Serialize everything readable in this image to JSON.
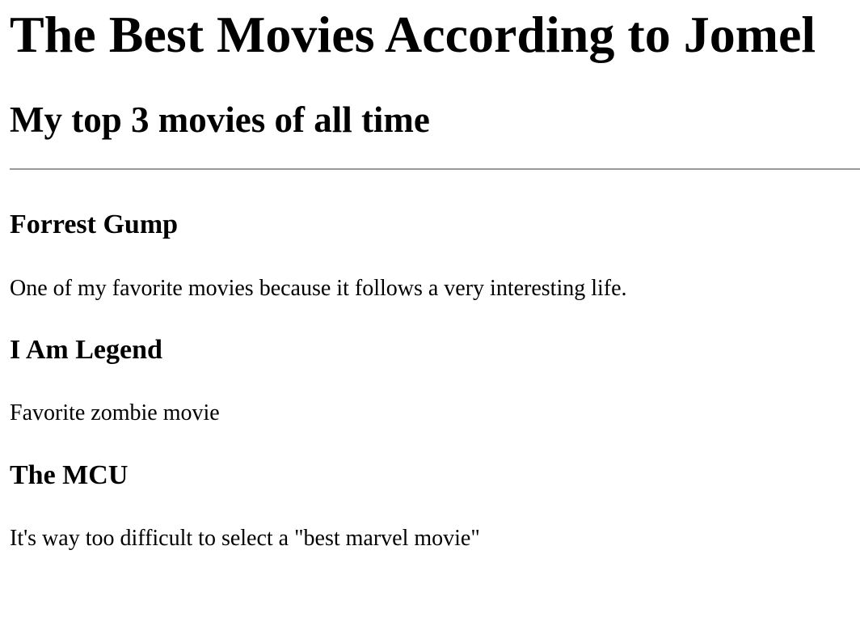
{
  "page": {
    "title": "The Best Movies According to Jomel",
    "subtitle": "My top 3 movies of all time"
  },
  "movies": [
    {
      "title": "Forrest Gump",
      "description": "One of my favorite movies because it follows a very interesting life."
    },
    {
      "title": "I Am Legend",
      "description": "Favorite zombie movie"
    },
    {
      "title": "The MCU",
      "description": "It's way too difficult to select a \"best marvel movie\""
    }
  ]
}
